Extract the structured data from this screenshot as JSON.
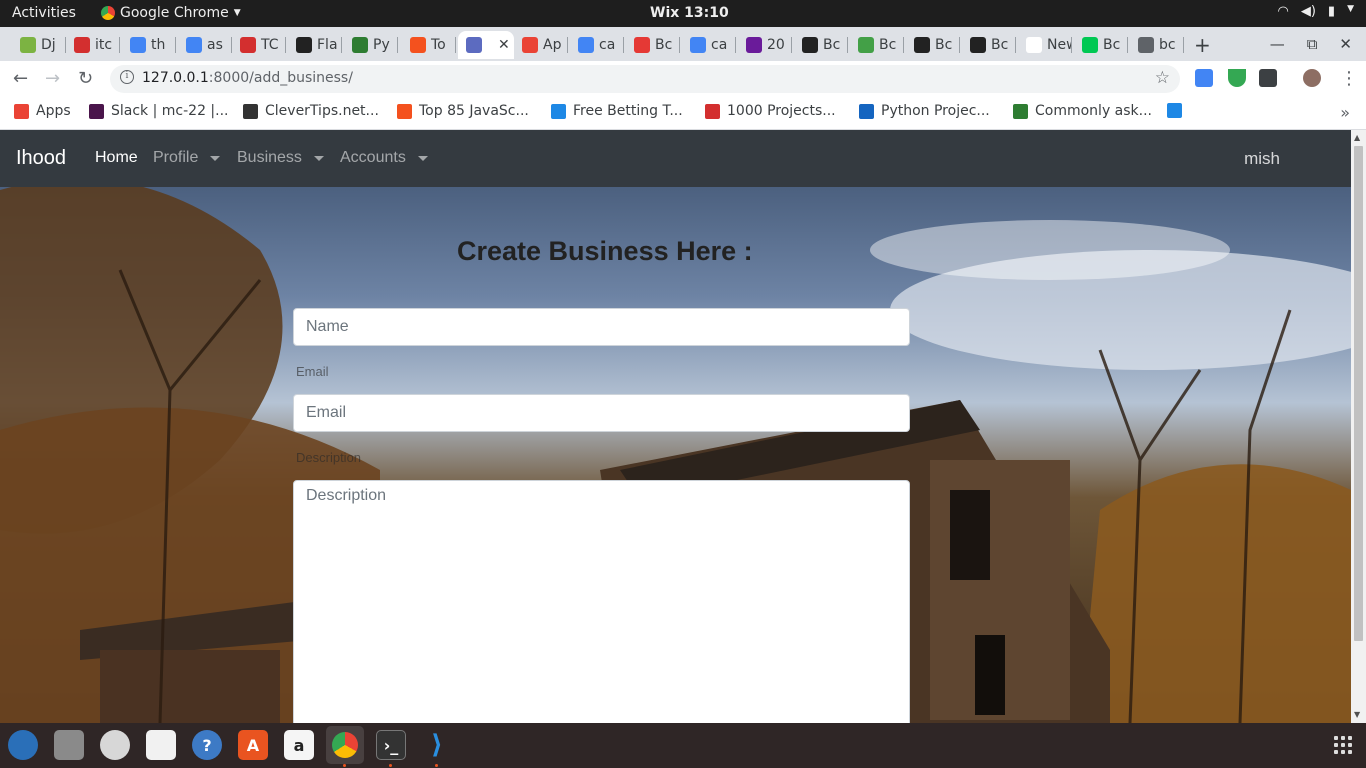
{
  "system_bar": {
    "activities": "Activities",
    "app_name": "Google Chrome",
    "clock": "Wix 13:10"
  },
  "tabs": [
    {
      "label": "Dj",
      "color": "#7cb342"
    },
    {
      "label": "itc",
      "color": "#d32f2f"
    },
    {
      "label": "th",
      "color": "#4285f4"
    },
    {
      "label": "as",
      "color": "#4285f4"
    },
    {
      "label": "TC",
      "color": "#d32f2f"
    },
    {
      "label": "Fla",
      "color": "#222222"
    },
    {
      "label": "Py",
      "color": "#2e7d32"
    },
    {
      "label": "To",
      "color": "#f4511e"
    },
    {
      "label": "",
      "color": "#5c6bc0"
    },
    {
      "label": "Ap",
      "color": "#ea4335"
    },
    {
      "label": "ca",
      "color": "#4285f4"
    },
    {
      "label": "Bc",
      "color": "#e53935"
    },
    {
      "label": "ca",
      "color": "#4285f4"
    },
    {
      "label": "20",
      "color": "#6a1b9a"
    },
    {
      "label": "Bc",
      "color": "#222222"
    },
    {
      "label": "Bc",
      "color": "#43a047"
    },
    {
      "label": "Bc",
      "color": "#222222"
    },
    {
      "label": "Bc",
      "color": "#222222"
    },
    {
      "label": "New T",
      "color": "#ffffff"
    },
    {
      "label": "Bc",
      "color": "#00c853"
    },
    {
      "label": "bc",
      "color": "#5f6368"
    }
  ],
  "omnibox": {
    "url_host": "127.0.0.1",
    "url_rest": ":8000/add_business/"
  },
  "bookmarks": [
    {
      "label": "Apps",
      "color": "#ea4335"
    },
    {
      "label": "Slack | mc-22 |...",
      "color": "#4a154b"
    },
    {
      "label": "CleverTips.net...",
      "color": "#333333"
    },
    {
      "label": "Top 85 JavaSc...",
      "color": "#f4511e"
    },
    {
      "label": "Free Betting T...",
      "color": "#1e88e5"
    },
    {
      "label": "1000 Projects...",
      "color": "#d32f2f"
    },
    {
      "label": "Python Projec...",
      "color": "#1565c0"
    },
    {
      "label": "Commonly ask...",
      "color": "#2e7d32"
    },
    {
      "label": "",
      "color": "#1e88e5"
    }
  ],
  "site": {
    "brand": "Ihood",
    "nav": {
      "home": "Home",
      "profile": "Profile",
      "business": "Business",
      "accounts": "Accounts"
    },
    "user": "mish"
  },
  "form": {
    "title": "Create Business Here :",
    "name_placeholder": "Name",
    "email_hint": "Email",
    "email_placeholder": "Email",
    "description_hint": "Description",
    "description_placeholder": "Description"
  }
}
